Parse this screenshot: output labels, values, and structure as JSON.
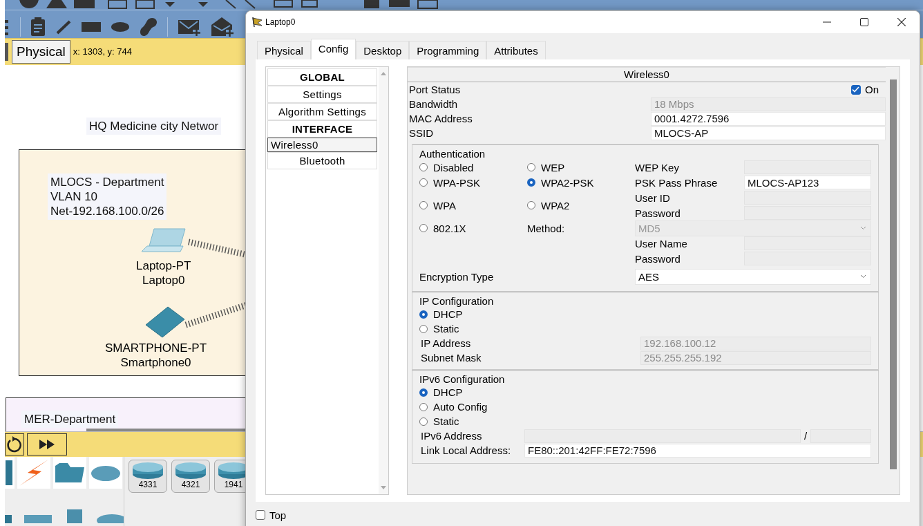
{
  "workspace": {
    "mode_button": "Physical",
    "cursor_position": "x: 1303, y: 744"
  },
  "canvas": {
    "title_note": "HQ Medicine city Networ",
    "areas": [
      {
        "note_lines": [
          "MLOCS - Department",
          "VLAN 10",
          "Net-192.168.100.0/26"
        ]
      },
      {
        "note_lines": [
          "MER-Department"
        ]
      }
    ],
    "devices": [
      {
        "kind": "laptop",
        "model": "Laptop-PT",
        "name": "Laptop0"
      },
      {
        "kind": "smartphone",
        "model": "SMARTPHONE-PT",
        "name": "Smartphone0"
      }
    ]
  },
  "palette": {
    "routers": [
      {
        "label": "4331"
      },
      {
        "label": "4321"
      },
      {
        "label": "1941"
      }
    ]
  },
  "dialog": {
    "title": "Laptop0",
    "tabs": [
      {
        "label": "Physical",
        "selected": false
      },
      {
        "label": "Config",
        "selected": true
      },
      {
        "label": "Desktop",
        "selected": false
      },
      {
        "label": "Programming",
        "selected": false
      },
      {
        "label": "Attributes",
        "selected": false
      }
    ],
    "sidebar": [
      {
        "label": "GLOBAL",
        "kind": "header",
        "selected": false
      },
      {
        "label": "Settings",
        "kind": "item",
        "selected": false
      },
      {
        "label": "Algorithm Settings",
        "kind": "item",
        "selected": false
      },
      {
        "label": "INTERFACE",
        "kind": "header",
        "selected": false
      },
      {
        "label": "Wireless0",
        "kind": "item",
        "selected": true
      },
      {
        "label": "Bluetooth",
        "kind": "item",
        "selected": false
      }
    ],
    "panel_title": "Wireless0",
    "port_status": {
      "label": "Port Status",
      "checkbox_label": "On",
      "checked": true
    },
    "info_fields": [
      {
        "label": "Bandwidth",
        "value": "18 Mbps",
        "disabled": true
      },
      {
        "label": "MAC Address",
        "value": "0001.4272.7596",
        "disabled": false
      },
      {
        "label": "SSID",
        "value": "MLOCS-AP",
        "disabled": false
      }
    ],
    "authentication": {
      "title": "Authentication",
      "options": [
        {
          "label": "Disabled",
          "selected": false
        },
        {
          "label": "WEP",
          "selected": false
        },
        {
          "label": "WPA-PSK",
          "selected": false
        },
        {
          "label": "WPA2-PSK",
          "selected": true
        },
        {
          "label": "WPA",
          "selected": false
        },
        {
          "label": "WPA2",
          "selected": false
        },
        {
          "label": "802.1X",
          "selected": false
        }
      ],
      "fields": [
        {
          "label": "WEP Key",
          "disabled": true
        },
        {
          "label": "PSK Pass Phrase",
          "value": "MLOCS-AP123",
          "disabled": false
        },
        {
          "label": "User ID",
          "disabled": true
        },
        {
          "label": "Password",
          "disabled": true
        },
        {
          "label": "User Name",
          "disabled": true
        },
        {
          "label": "Password",
          "disabled": true
        }
      ],
      "method": {
        "label": "Method:",
        "value": "MD5",
        "disabled": true
      },
      "encryption": {
        "label": "Encryption Type",
        "value": "AES",
        "disabled": false
      }
    },
    "ip_config": {
      "title": "IP Configuration",
      "options": [
        {
          "label": "DHCP",
          "selected": true
        },
        {
          "label": "Static",
          "selected": false
        }
      ],
      "fields": [
        {
          "label": "IP Address",
          "value": "192.168.100.12",
          "disabled": true
        },
        {
          "label": "Subnet Mask",
          "value": "255.255.255.192",
          "disabled": true
        }
      ]
    },
    "ipv6_config": {
      "title": "IPv6 Configuration",
      "options": [
        {
          "label": "DHCP",
          "selected": true
        },
        {
          "label": "Auto Config",
          "selected": false
        },
        {
          "label": "Static",
          "selected": false
        }
      ],
      "address": {
        "label": "IPv6 Address",
        "separator": "/",
        "disabled": true
      },
      "link_local": {
        "label": "Link Local Address:",
        "value": "FE80::201:42FF:FE72:7596",
        "disabled": false
      }
    },
    "top_checkbox": {
      "label": "Top",
      "checked": false
    }
  }
}
